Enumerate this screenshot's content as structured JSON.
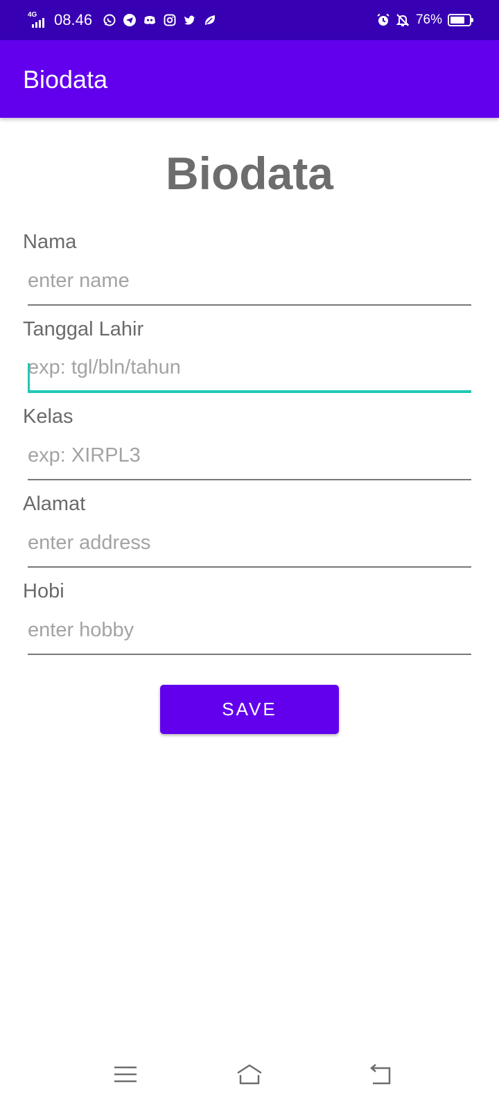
{
  "status_bar": {
    "network": "4G",
    "time": "08.46",
    "battery_percent": "76%",
    "battery_level": 0.76,
    "notification_icons": [
      "whatsapp-icon",
      "telegram-icon",
      "discord-icon",
      "instagram-icon",
      "twitter-icon",
      "leaf-icon"
    ],
    "right_icons": [
      "alarm-icon",
      "notifications-off-icon",
      "battery-icon"
    ]
  },
  "app_bar": {
    "title": "Biodata"
  },
  "form": {
    "heading": "Biodata",
    "fields": [
      {
        "label": "Nama",
        "placeholder": "enter name",
        "value": ""
      },
      {
        "label": "Tanggal Lahir",
        "placeholder": "exp: tgl/bln/tahun",
        "value": "",
        "focused": true
      },
      {
        "label": "Kelas",
        "placeholder": "exp: XIRPL3",
        "value": ""
      },
      {
        "label": "Alamat",
        "placeholder": "enter address",
        "value": ""
      },
      {
        "label": "Hobi",
        "placeholder": "enter hobby",
        "value": ""
      }
    ],
    "save_label": "SAVE"
  },
  "nav_bar": {
    "buttons": [
      "menu-icon",
      "home-icon",
      "back-icon"
    ]
  },
  "colors": {
    "status_bar": "#3700b3",
    "primary": "#6200ee",
    "focus_accent": "#1fc8b4",
    "label_text": "#6a6a6a",
    "hint_text": "#a3a3a3"
  }
}
